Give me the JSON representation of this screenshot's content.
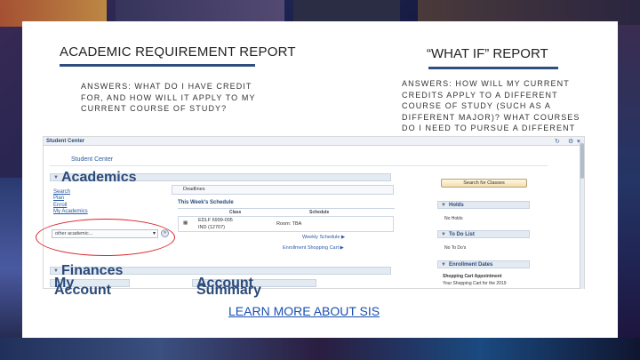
{
  "slide": {
    "left_heading": "ACADEMIC REQUIREMENT REPORT",
    "left_answer": "ANSWERS: WHAT DO I HAVE CREDIT FOR, AND HOW WILL IT APPLY TO MY CURRENT COURSE OF STUDY?",
    "right_heading": "“WHAT IF” REPORT",
    "right_answer": "ANSWERS: HOW WILL MY CURRENT CREDITS APPLY TO A DIFFERENT COURSE OF STUDY (SUCH AS A DIFFERENT MAJOR)? WHAT COURSES DO I NEED TO PURSUE A DIFFERENT COURSE OF STUDY?",
    "learn_link": "LEARN MORE ABOUT SIS",
    "accent_color": "#2f4f7f",
    "oval_color": "#d9252b"
  },
  "sis": {
    "bar_title": "Student Center",
    "page_title": "Student Center",
    "academics_header": "Academics",
    "links": [
      "Search",
      "Plan",
      "Enroll",
      "My Academics"
    ],
    "dropdown_value": "other academic...",
    "deadlines": "Deadlines",
    "schedule_title": "This Week's Schedule",
    "col_class": "Class",
    "col_schedule": "Schedule",
    "class_line1": "EDLF 6999-005",
    "class_line2": "IND (12707)",
    "room": "Room: TBA",
    "weekly_schedule": "Weekly Schedule",
    "enrollment_cart": "Enrollment Shopping Cart",
    "finances_header": "Finances",
    "my_account": "My Account",
    "account_summary": "Account Summary",
    "search_button": "Search for Classes",
    "holds_header": "Holds",
    "no_holds": "No Holds",
    "todo_header": "To Do List",
    "no_todos": "No To Do's",
    "enroll_dates_header": "Enrollment Dates",
    "cart_appt": "Shopping Cart Appointment",
    "cart_appt_sub": "Your Shopping Cart for the 2019"
  }
}
